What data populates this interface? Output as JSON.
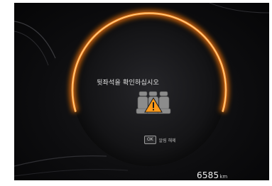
{
  "cluster": {
    "warning_message": "뒷좌석을 확인하십시오",
    "ok_key": "OK",
    "ok_action": "알림 해제",
    "odometer_value": "6585",
    "odometer_unit": "km"
  },
  "icons": {
    "seats": "rear-seats-icon",
    "warning": "warning-triangle-icon"
  },
  "colors": {
    "ring_glow": "#ff8a1f",
    "ring_core": "#ffd08a",
    "warning_amber": "#ff9a1a",
    "background": "#0d0d0f"
  }
}
